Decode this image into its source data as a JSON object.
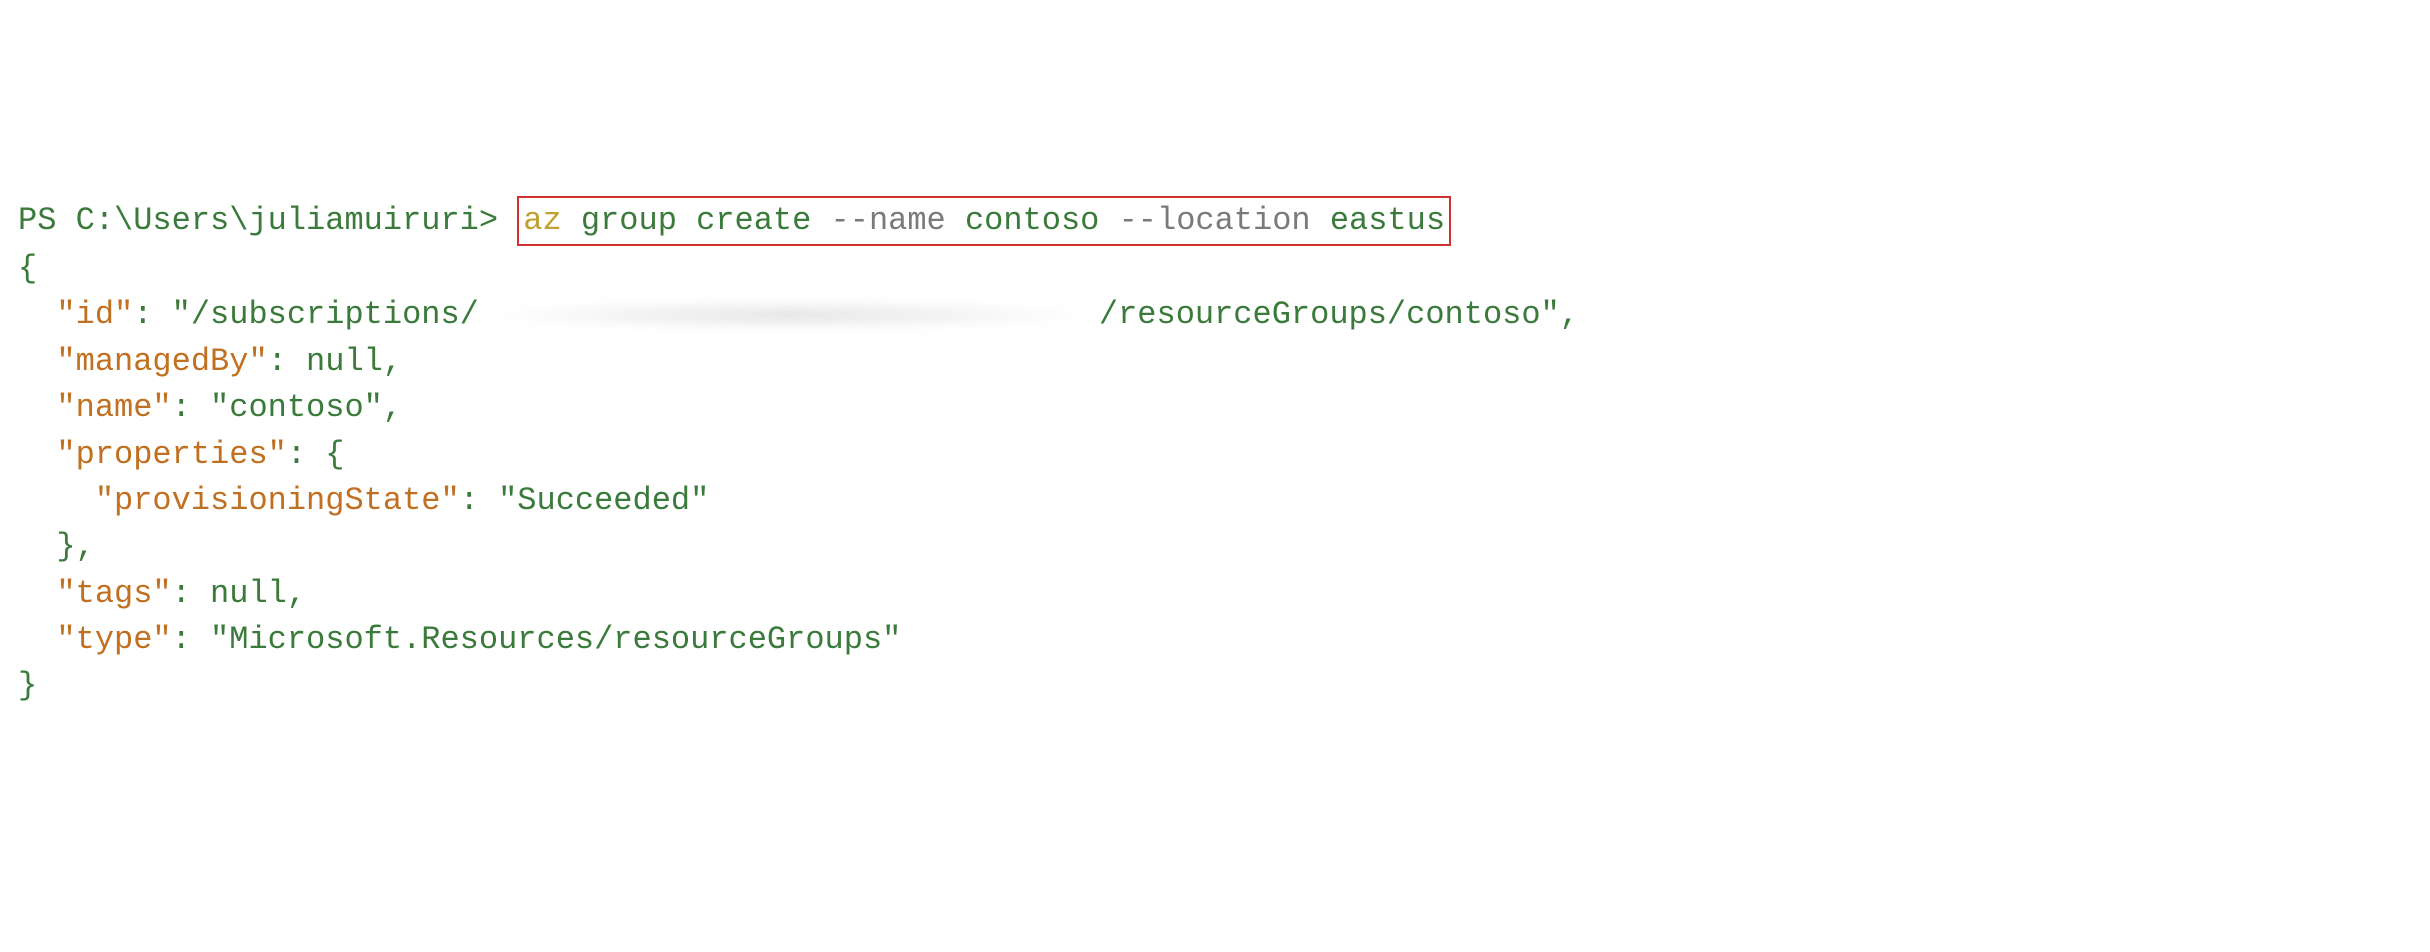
{
  "prompt": "PS C:\\Users\\juliamuiruri> ",
  "command": {
    "cmd": "az",
    "arg1": "group",
    "arg2": "create",
    "flag1": "--name",
    "val1": "contoso",
    "flag2": "--location",
    "val2": "eastus"
  },
  "output": {
    "keys": {
      "id": "\"id\"",
      "managedBy": "\"managedBy\"",
      "name": "\"name\"",
      "properties": "\"properties\"",
      "provisioningState": "\"provisioningState\"",
      "tags": "\"tags\"",
      "type": "\"type\""
    },
    "vals": {
      "id_prefix": "\"/subscriptions/",
      "id_suffix": "/resourceGroups/contoso\"",
      "managedBy": "null",
      "name": "\"contoso\"",
      "provisioningState": "\"Succeeded\"",
      "tags": "null",
      "type": "\"Microsoft.Resources/resourceGroups\""
    },
    "braces": {
      "open": "{",
      "close": "}",
      "comma": ","
    },
    "colon": ": "
  }
}
